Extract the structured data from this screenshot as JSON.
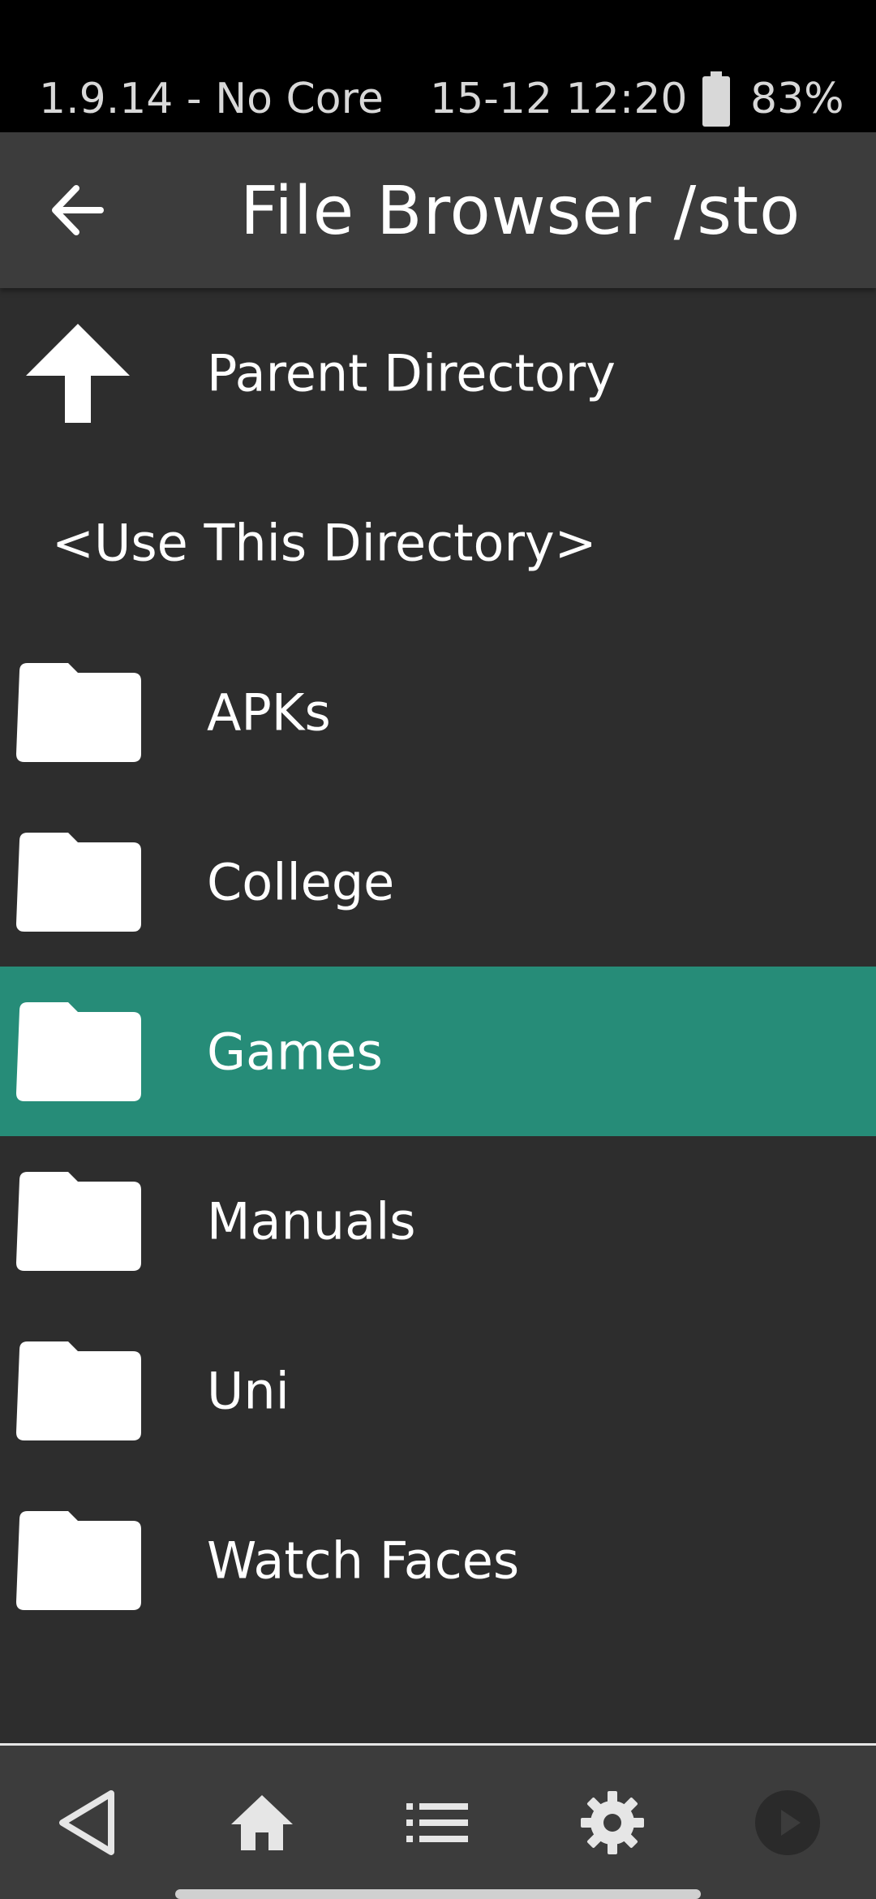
{
  "status_bar": {
    "left_text": "1.9.14 - No Core",
    "datetime": "15-12 12:20",
    "battery": "83%",
    "battery_icon": "battery-icon"
  },
  "app_bar": {
    "back_icon": "arrow-left-icon",
    "title": "File Browser /sto"
  },
  "list": {
    "parent": {
      "label": "Parent Directory",
      "icon": "arrow-up-icon"
    },
    "use_directory": {
      "label": "<Use This Directory>"
    },
    "folders": [
      {
        "label": "APKs",
        "icon": "folder-icon"
      },
      {
        "label": "College",
        "icon": "folder-icon"
      },
      {
        "label": "Games",
        "icon": "folder-icon",
        "selected": true
      },
      {
        "label": "Manuals",
        "icon": "folder-icon"
      },
      {
        "label": "Uni",
        "icon": "folder-icon"
      },
      {
        "label": "Watch Faces",
        "icon": "folder-icon"
      }
    ]
  },
  "bottom_nav": [
    {
      "icon": "back-triangle-icon"
    },
    {
      "icon": "home-icon"
    },
    {
      "icon": "list-icon"
    },
    {
      "icon": "gear-icon"
    },
    {
      "icon": "play-icon"
    }
  ],
  "colors": {
    "selected_row": "#268c78",
    "background": "#2d2d2d",
    "app_bar": "#3c3c3c"
  }
}
